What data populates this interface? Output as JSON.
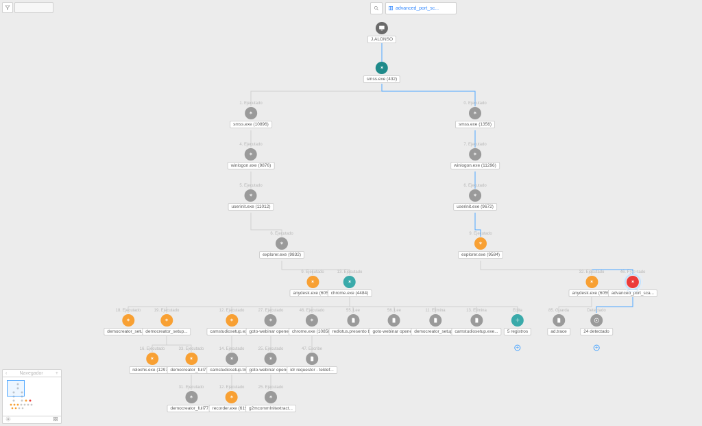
{
  "toolbar": {
    "search_value": "advanced_port_sc..."
  },
  "minimap": {
    "title": "Navegador"
  },
  "nodes": {
    "root": {
      "label": "J.ALONSO"
    },
    "p0": {
      "label": "smss.exe (432)"
    },
    "c1": {
      "caption": "1. Ejecutado",
      "label": "smss.exe (10896)"
    },
    "c2": {
      "caption": "4. Ejecutado",
      "label": "winlogon.exe (9876)"
    },
    "c3": {
      "caption": "5. Ejecutado",
      "label": "userinit.exe (11012)"
    },
    "c4": {
      "caption": "6. Ejecutado",
      "label": "explorer.exe (9832)"
    },
    "c5": {
      "caption": "9. Ejecutado",
      "label": "anydesk.exe (6052)"
    },
    "c6": {
      "caption": "13. Ejecutado",
      "label": "chrome.exe (4484)"
    },
    "r1": {
      "caption": "0. Ejecutado",
      "label": "smss.exe (1356)"
    },
    "r2": {
      "caption": "7. Ejecutado",
      "label": "winlogon.exe (11296)"
    },
    "r3": {
      "caption": "6. Ejecutado",
      "label": "userinit.exe (9672)"
    },
    "r4": {
      "caption": "9. Ejecutado",
      "label": "explorer.exe (9584)"
    },
    "r5": {
      "caption": "32. Ejecutado",
      "label": "anydesk.exe (6059)"
    },
    "r6": {
      "caption": "46. Ejecutado",
      "label": "advanced_port_sca..."
    },
    "g1": {
      "caption": "18. Ejecutado",
      "label": "democreator_setup..."
    },
    "g2": {
      "caption": "19. Ejecutado",
      "label": "democreator_setup..."
    },
    "g3": {
      "caption": "12. Ejecutado",
      "label": "camstudiosetup.exe..."
    },
    "g4": {
      "caption": "27. Ejecutado",
      "label": "goto-webinar opene..."
    },
    "g5": {
      "caption": "46. Ejecutado",
      "label": "chrome.exe (10858)"
    },
    "g6": {
      "caption": "55. Lee",
      "label": "redlotus.presento b..."
    },
    "g7": {
      "caption": "56. Lee",
      "label": "goto-webinar opene..."
    },
    "g8": {
      "caption": "11. Elimina",
      "label": "democreator_setup..."
    },
    "g9": {
      "caption": "13. Elimina",
      "label": "camstudiosetup.exe..."
    },
    "g10": {
      "caption": "Edita",
      "label": "5 registros"
    },
    "g11": {
      "caption": "85. Guarda",
      "label": "ad.trace"
    },
    "g12": {
      "caption": "Detectado",
      "label": "24 detectado"
    },
    "h1": {
      "caption": "16. Ejecutado",
      "label": "relochk.exe (12976)"
    },
    "h2": {
      "caption": "33. Ejecutado",
      "label": "democreator_full77..."
    },
    "h3": {
      "caption": "14. Ejecutado",
      "label": "camstudiosetup.tmp..."
    },
    "h4": {
      "caption": "25. Ejecutado",
      "label": "goto-webinar opene..."
    },
    "h5": {
      "caption": "47. Escribe",
      "label": "idr requestor - teldef..."
    },
    "i1": {
      "caption": "31. Ejecutado",
      "label": "democreator_full77..."
    },
    "i2": {
      "caption": "12. Ejecutado",
      "label": "recorder.exe (6196)"
    },
    "i3": {
      "caption": "25. Ejecutado",
      "label": "g2mcommInitextract..."
    }
  }
}
